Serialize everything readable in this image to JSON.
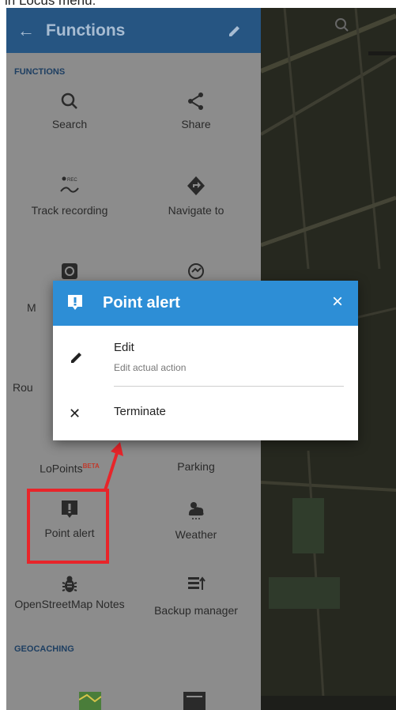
{
  "caption": "in Locus menu:",
  "drawer": {
    "title": "Functions",
    "section_functions": "FUNCTIONS",
    "section_geocaching": "GEOCACHING",
    "items": [
      {
        "label": "Search",
        "icon": "search-icon"
      },
      {
        "label": "Share",
        "icon": "share-icon"
      },
      {
        "label": "Track recording",
        "icon": "track-recording-icon"
      },
      {
        "label": "Navigate to",
        "icon": "navigate-icon"
      },
      {
        "label": "M",
        "icon": "map-icon"
      },
      {
        "label": "",
        "icon": "sync-icon"
      },
      {
        "label": "Rou",
        "icon": "route-icon"
      },
      {
        "label": "LoPoints",
        "badge": "BETA",
        "icon": "lopoints-icon"
      },
      {
        "label": "Parking",
        "icon": "parking-icon"
      },
      {
        "label": "Point alert",
        "icon": "point-alert-icon"
      },
      {
        "label": "Weather",
        "icon": "weather-icon"
      },
      {
        "label": "OpenStreetMap Notes",
        "icon": "bug-icon"
      },
      {
        "label": "Backup manager",
        "icon": "backup-icon"
      }
    ]
  },
  "dialog": {
    "title": "Point alert",
    "edit_label": "Edit",
    "edit_sub": "Edit actual action",
    "terminate_label": "Terminate"
  },
  "colors": {
    "header_dark": "#265582",
    "dialog_header": "#2d8ed6",
    "annotation": "#e8252a"
  }
}
